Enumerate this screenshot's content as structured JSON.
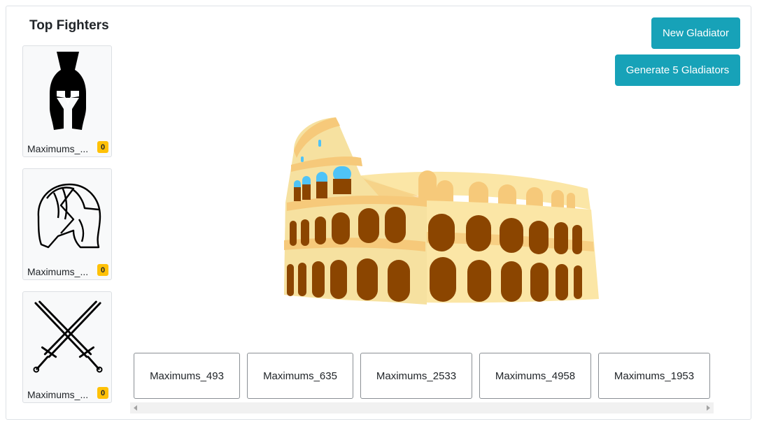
{
  "sidebar": {
    "title": "Top Fighters",
    "fighters": [
      {
        "name": "Maximums_...",
        "score": "0",
        "icon": "spartan-helmet-icon"
      },
      {
        "name": "Maximums_...",
        "score": "0",
        "icon": "gladiator-helmet-icon"
      },
      {
        "name": "Maximums_...",
        "score": "0",
        "icon": "crossed-swords-icon"
      }
    ]
  },
  "actions": {
    "new_gladiator": "New Gladiator",
    "generate_five": "Generate 5 Gladiators"
  },
  "arena": {
    "icon": "colosseum-illustration"
  },
  "gladiators": [
    "Maximums_493",
    "Maximums_635",
    "Maximums_2533",
    "Maximums_4958",
    "Maximums_1953"
  ],
  "colors": {
    "accent": "#17a2b8",
    "badge": "#ffc107",
    "colosseum_light": "#fbe6a6",
    "colosseum_mid": "#f6c97a",
    "colosseum_arch": "#8b4500",
    "colosseum_window": "#4fc3f7"
  }
}
